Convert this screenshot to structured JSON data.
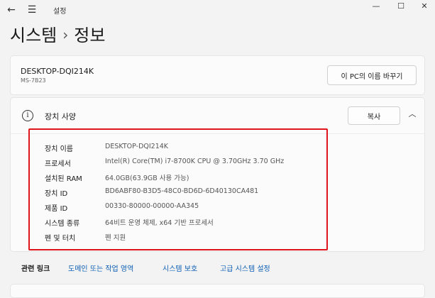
{
  "titlebar": {
    "app_title": "설정",
    "back_glyph": "←",
    "menu_glyph": "☰",
    "minimize_glyph": "—",
    "maximize_glyph": "☐",
    "close_glyph": "✕"
  },
  "breadcrumb": {
    "parent": "시스템",
    "separator": "›",
    "current": "정보"
  },
  "pc_card": {
    "device_name": "DESKTOP-DQI214K",
    "model": "MS-7B23",
    "rename_button": "이 PC의 이름 바꾸기"
  },
  "spec_card": {
    "info_glyph": "i",
    "title": "장치 사양",
    "copy_button": "복사",
    "chevron_glyph": "︿",
    "rows": [
      {
        "label": "장치 이름",
        "value": "DESKTOP-DQI214K"
      },
      {
        "label": "프로세서",
        "value": "Intel(R) Core(TM) i7-8700K CPU @ 3.70GHz   3.70 GHz"
      },
      {
        "label": "설치된 RAM",
        "value": "64.0GB(63.9GB 사용 가능)"
      },
      {
        "label": "장치 ID",
        "value": "BD6ABF80-B3D5-48C0-BD6D-6D40130CA481"
      },
      {
        "label": "제품 ID",
        "value": "00330-80000-00000-AA345"
      },
      {
        "label": "시스템 종류",
        "value": "64비트 운영 체제, x64 기반 프로세서"
      },
      {
        "label": "펜 및 터치",
        "value": "펜 지원"
      }
    ]
  },
  "related": {
    "label": "관련 링크",
    "links": [
      "도메인 또는 작업 영역",
      "시스템 보호",
      "고급 시스템 설정"
    ]
  },
  "colors": {
    "highlight": "#e0141b",
    "link": "#0e5fb5"
  }
}
